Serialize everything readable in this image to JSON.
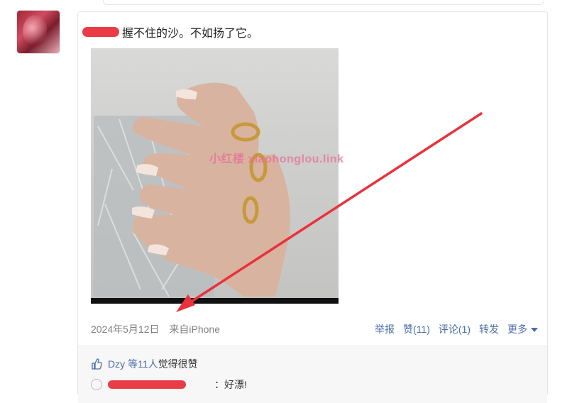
{
  "post": {
    "text": "握不住的沙。不如扬了它。",
    "date": "2024年5月12日",
    "source": "来自iPhone",
    "watermark": "小红楼  xiaohonglou.link"
  },
  "actions": {
    "report": "举报",
    "like": "赞(11)",
    "comment": "评论(1)",
    "repost": "转发",
    "more": "更多"
  },
  "likes": {
    "user": "Dzy",
    "count_text": "等11人",
    "suffix": "觉得很赞"
  },
  "comment": {
    "text": "：好漂!"
  },
  "colors": {
    "link": "#4a6ea9",
    "redaction": "#e8323c",
    "arrow": "#e8323c"
  }
}
